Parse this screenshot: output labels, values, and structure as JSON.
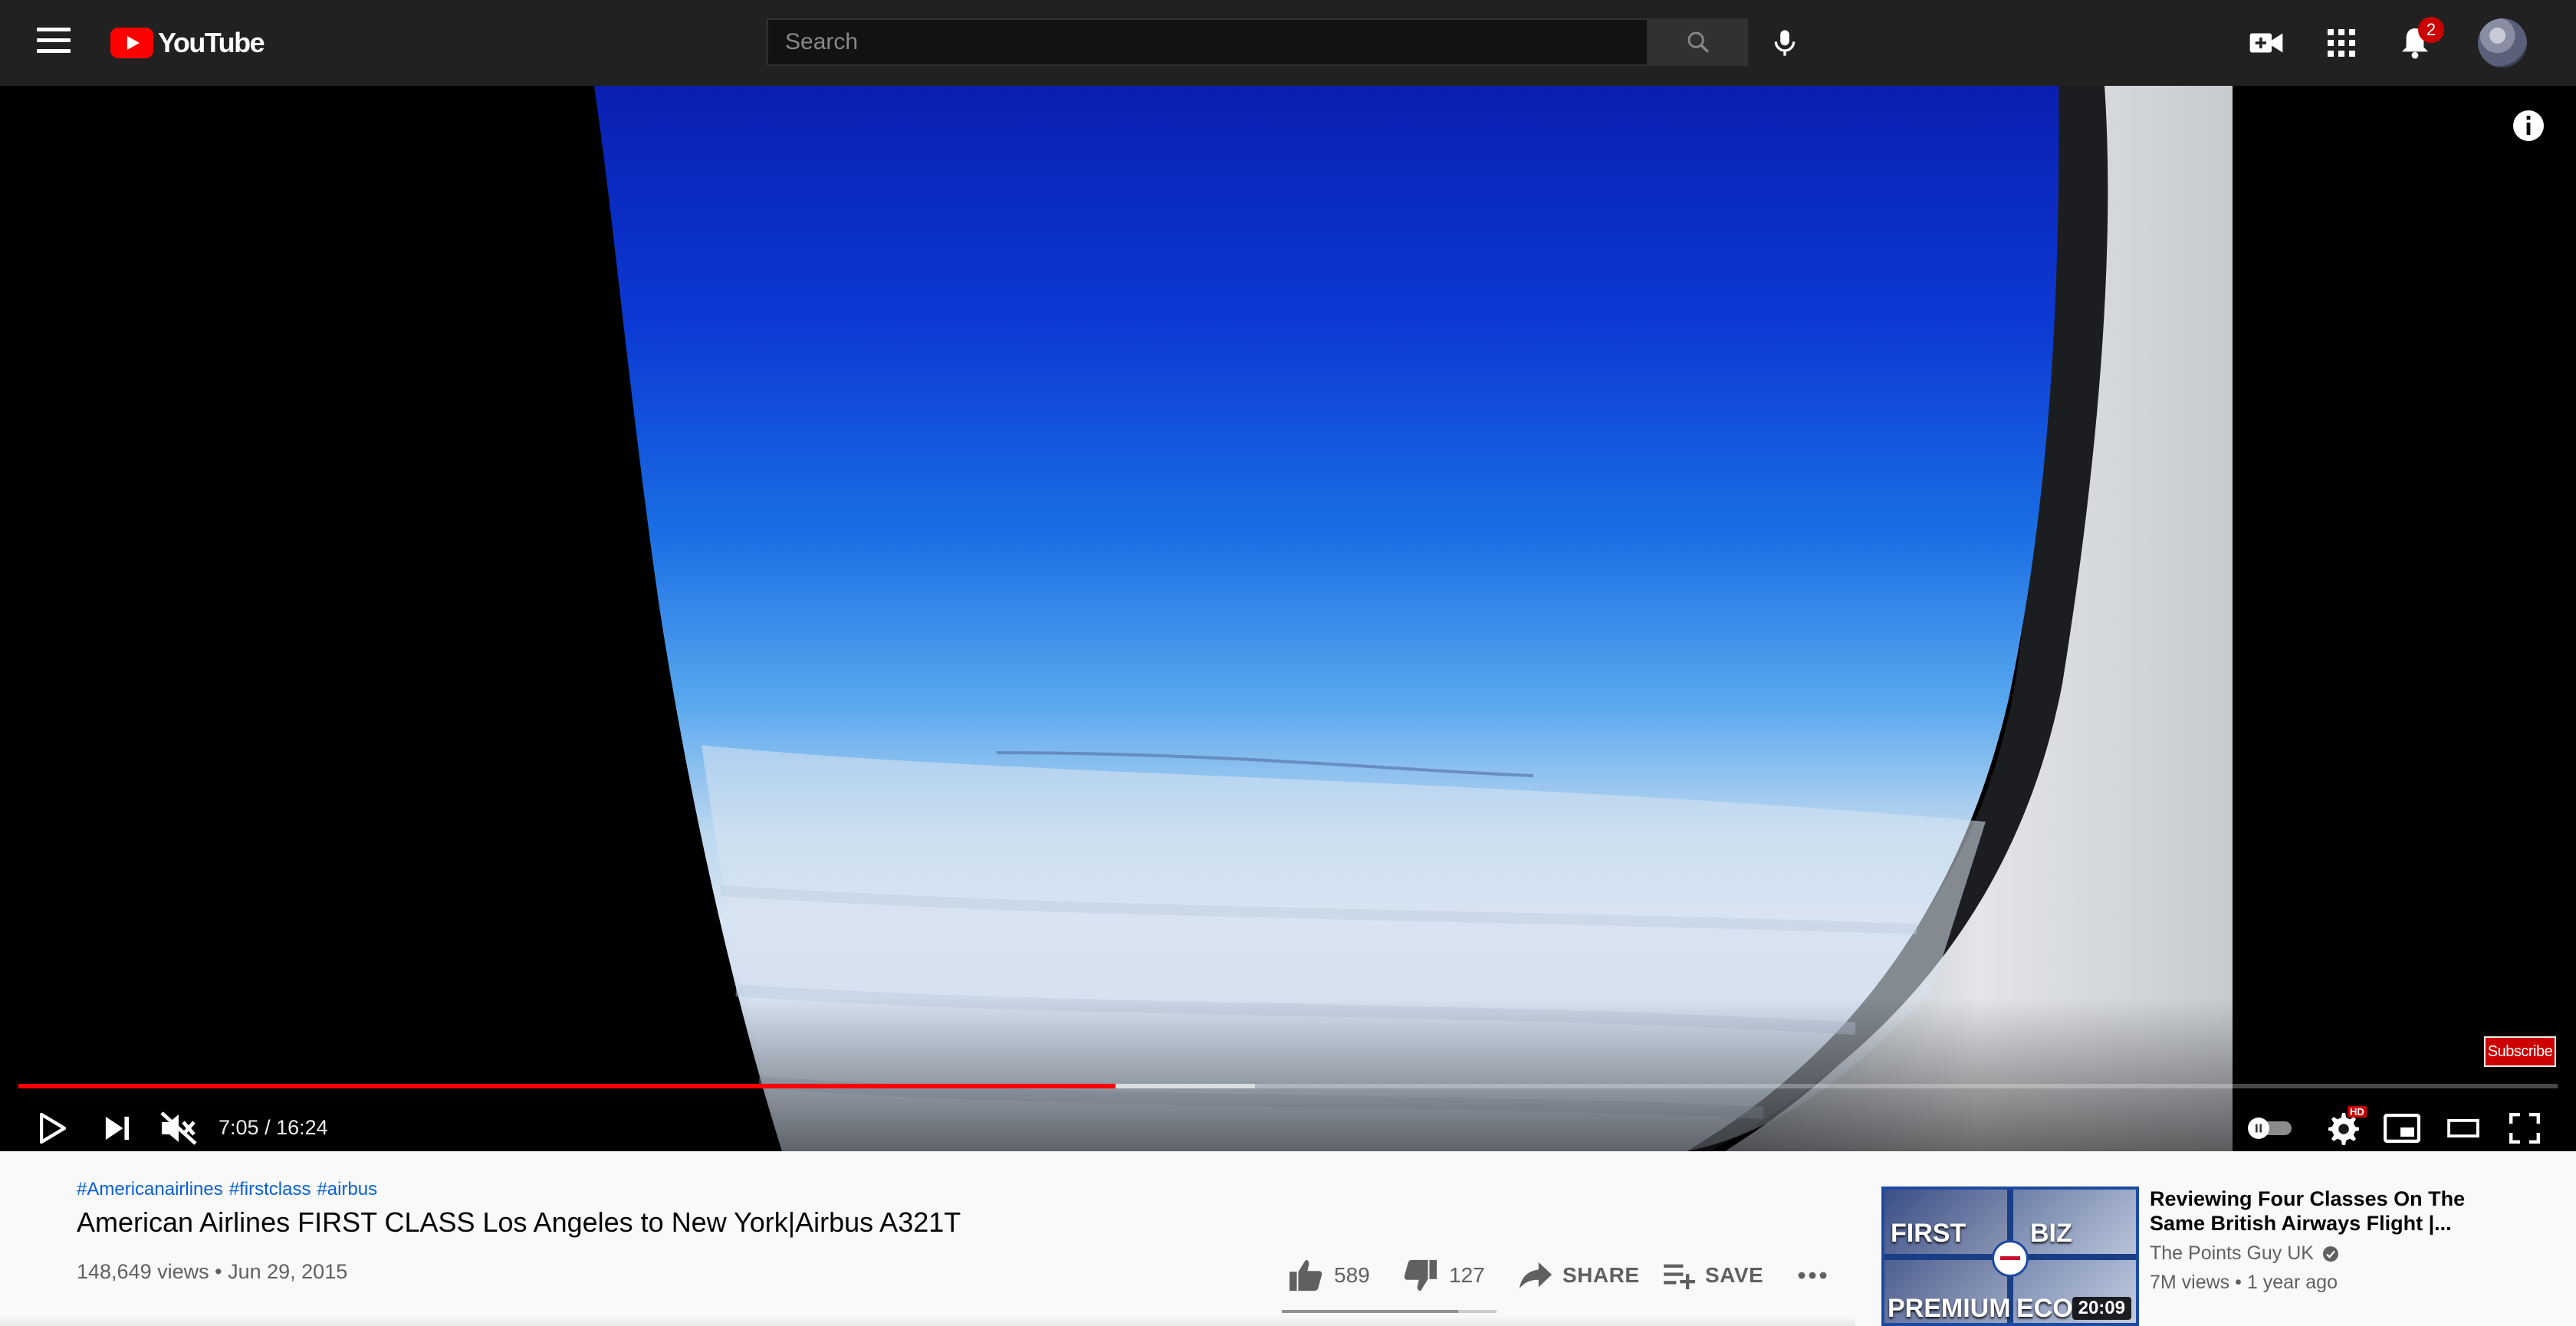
{
  "header": {
    "logo_text": "YouTube",
    "search": {
      "placeholder": "Search",
      "value": ""
    },
    "notifications_count": "2"
  },
  "player": {
    "current_time": "7:05",
    "duration": "16:24",
    "time_separator": " / ",
    "progress_fraction": 0.432,
    "buffered_fraction": 0.487,
    "muted": true,
    "autoplay_on": false,
    "watermark_text": "Subscribe",
    "hd_badge": "HD"
  },
  "video": {
    "hashtags": [
      "#Americanairlines",
      "#firstclass",
      "#airbus"
    ],
    "title": "American Airlines FIRST CLASS Los Angeles to New York|Airbus A321T",
    "views": "148,649 views",
    "date": "Jun 29, 2015",
    "meta_separator": " • ",
    "likes": "589",
    "dislikes": "127",
    "share_label": "SHARE",
    "save_label": "SAVE",
    "like_ratio": 0.823
  },
  "recommendation": {
    "title": "Reviewing Four Classes On The Same British Airways Flight |...",
    "channel": "The Points Guy UK",
    "views": "7M views",
    "age": "1 year ago",
    "duration": "20:09",
    "thumb_labels": [
      "FIRST",
      "BIZ",
      "PREMIUM",
      "ECO"
    ]
  },
  "colors": {
    "brand_red": "#ff0000",
    "link_blue": "#065fd4",
    "topbar_bg": "#212121"
  },
  "icons": [
    "menu-icon",
    "search-icon",
    "mic-icon",
    "create-video-icon",
    "apps-grid-icon",
    "bell-icon",
    "info-icon",
    "play-icon",
    "next-icon",
    "volume-muted-icon",
    "autoplay-toggle-icon",
    "settings-gear-icon",
    "miniplayer-icon",
    "theater-mode-icon",
    "fullscreen-icon",
    "thumbs-up-icon",
    "thumbs-down-icon",
    "share-arrow-icon",
    "playlist-add-icon",
    "more-horiz-icon",
    "verified-check-icon"
  ]
}
